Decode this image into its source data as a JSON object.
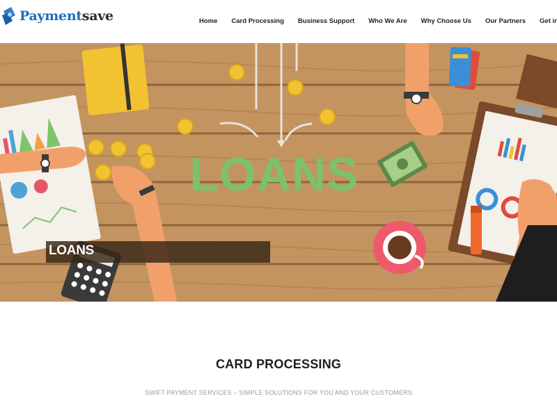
{
  "brand": {
    "name_part1": "Payment",
    "name_part2": "save"
  },
  "nav": {
    "items": [
      "Home",
      "Card Processing",
      "Business Support",
      "Who We Are",
      "Why Choose Us",
      "Our Partners",
      "Get in Touch"
    ]
  },
  "hero": {
    "headline": "LOANS",
    "caption": "LOANS"
  },
  "section": {
    "title": "CARD PROCESSING",
    "subtitle": "SWIFT PAYMENT SERVICES – SIMPLE SOLUTIONS FOR YOU AND YOUR CUSTOMERS"
  },
  "colors": {
    "brand_blue": "#1d6fb8",
    "wood": "#c39460",
    "loans_green": "#7bc26a",
    "coin_yellow": "#f2c230"
  }
}
